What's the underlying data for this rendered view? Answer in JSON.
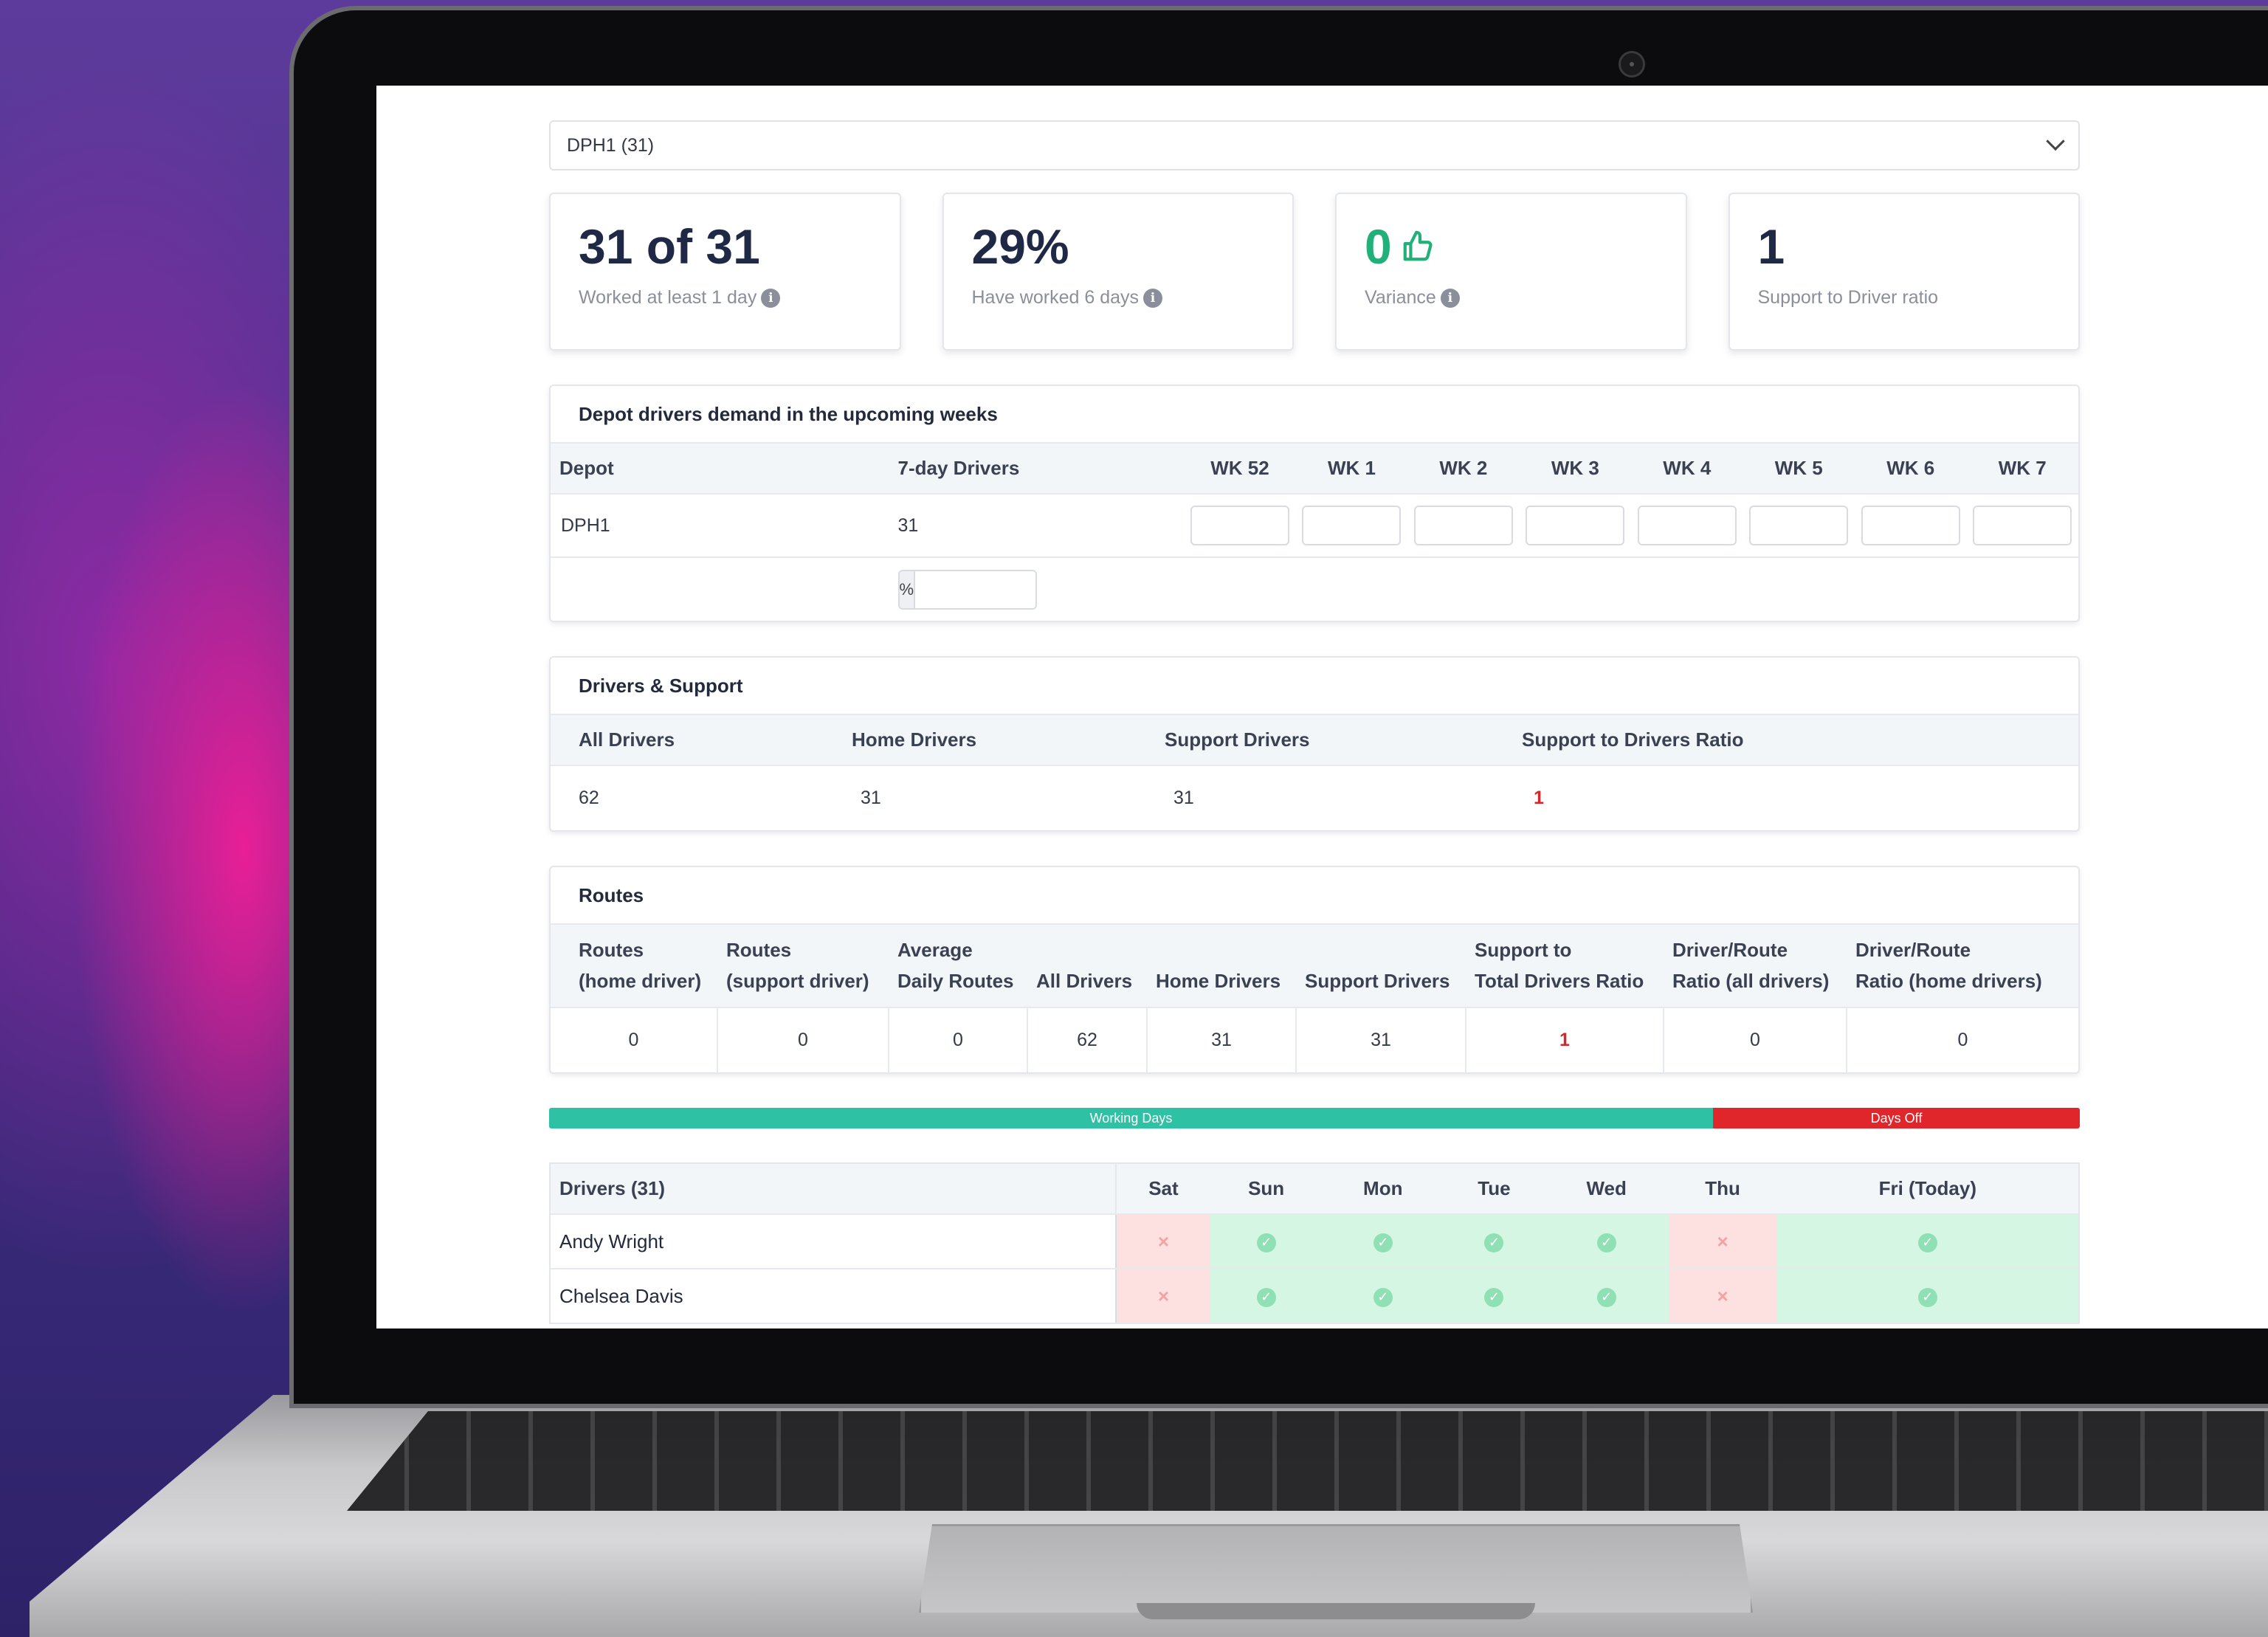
{
  "depot_select": {
    "value": "DPH1 (31)"
  },
  "stats": [
    {
      "value": "31 of 31",
      "label": "Worked at least 1 day",
      "info": true
    },
    {
      "value": "29%",
      "label": "Have worked 6 days",
      "info": true
    },
    {
      "value": "0",
      "label": "Variance",
      "info": true,
      "positive": true
    },
    {
      "value": "1",
      "label": "Support to Driver ratio",
      "info": false
    }
  ],
  "demand": {
    "title": "Depot drivers demand in the upcoming weeks",
    "headers": [
      "Depot",
      "7-day Drivers",
      "WK 52",
      "WK 1",
      "WK 2",
      "WK 3",
      "WK 4",
      "WK 5",
      "WK 6",
      "WK 7"
    ],
    "row": {
      "depot": "DPH1",
      "drivers": "31"
    },
    "percent_symbol": "%"
  },
  "drivers_support": {
    "title": "Drivers & Support",
    "headers": [
      "All Drivers",
      "Home Drivers",
      "Support Drivers",
      "Support to Drivers Ratio"
    ],
    "values": [
      "62",
      "31",
      "31",
      "1"
    ]
  },
  "routes": {
    "title": "Routes",
    "headers": [
      [
        "Routes",
        "(home driver)"
      ],
      [
        "Routes",
        "(support driver)"
      ],
      [
        "Average",
        "Daily Routes"
      ],
      [
        "",
        "All Drivers"
      ],
      [
        "",
        "Home Drivers"
      ],
      [
        "",
        "Support Drivers"
      ],
      [
        "Support to",
        "Total Drivers Ratio"
      ],
      [
        "Driver/Route",
        "Ratio (all drivers)"
      ],
      [
        "Driver/Route",
        "Ratio (home drivers)"
      ]
    ],
    "values": [
      "0",
      "0",
      "0",
      "62",
      "31",
      "31",
      "1",
      "0",
      "0"
    ]
  },
  "legend": {
    "working": "Working Days",
    "off": "Days Off",
    "colors": {
      "working": "#2fc1a4",
      "off": "#e0262a"
    }
  },
  "roster": {
    "title": "Drivers (31)",
    "days": [
      "Sat",
      "Sun",
      "Mon",
      "Tue",
      "Wed",
      "Thu",
      "Fri (Today)"
    ],
    "drivers": [
      {
        "name": "Andy Wright",
        "days": [
          false,
          true,
          true,
          true,
          true,
          false,
          true
        ]
      },
      {
        "name": "Chelsea Davis",
        "days": [
          false,
          true,
          true,
          true,
          true,
          false,
          true
        ]
      }
    ]
  },
  "icons": {
    "info": "info-icon",
    "thumb": "thumbs-up-icon",
    "ok": "check-circle-icon",
    "off": "x-mark-icon",
    "dropdown": "chevron-down-icon"
  }
}
